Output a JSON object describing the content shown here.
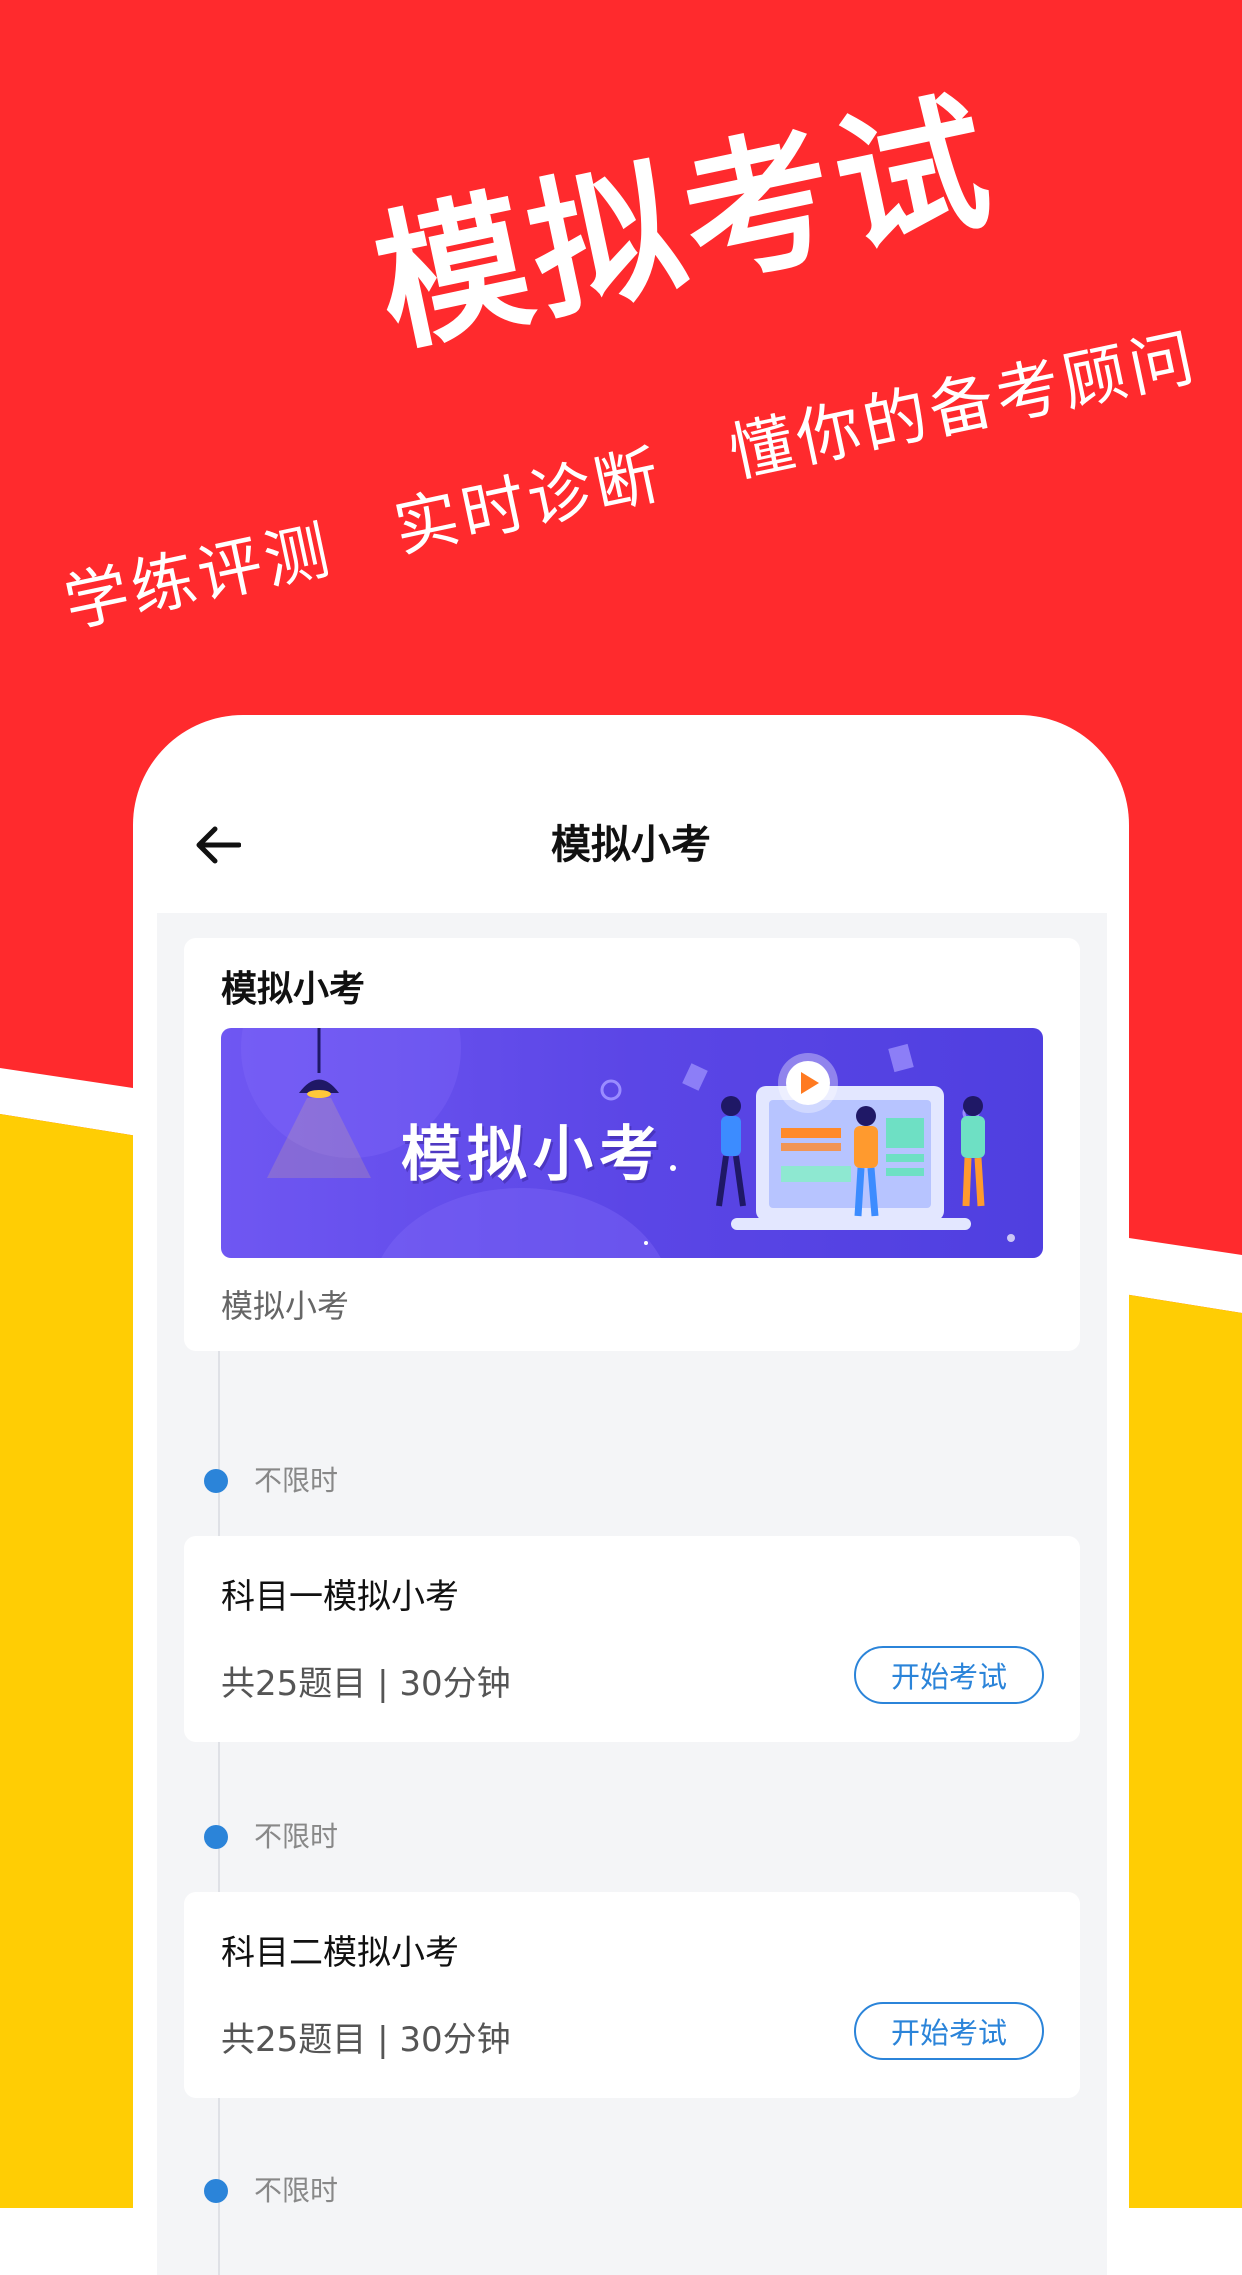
{
  "hero": {
    "title": "模拟考试",
    "taglines": [
      "学练评测",
      "实时诊断",
      "懂你的备考顾问"
    ]
  },
  "header": {
    "back_icon": "arrow-left-icon",
    "title": "模拟小考"
  },
  "intro_card": {
    "heading": "模拟小考",
    "banner_text": "模拟小考",
    "caption": "模拟小考"
  },
  "exams": [
    {
      "time_limit": "不限时",
      "title": "科目一模拟小考",
      "meta": "共25题目 | 30分钟",
      "button": "开始考试"
    },
    {
      "time_limit": "不限时",
      "title": "科目二模拟小考",
      "meta": "共25题目 | 30分钟",
      "button": "开始考试"
    },
    {
      "time_limit": "不限时"
    }
  ],
  "colors": {
    "background_red": "#ff2a2d",
    "background_yellow": "#ffcd04",
    "accent_blue": "#2b84d9",
    "banner_purple": "#5b46e6"
  }
}
